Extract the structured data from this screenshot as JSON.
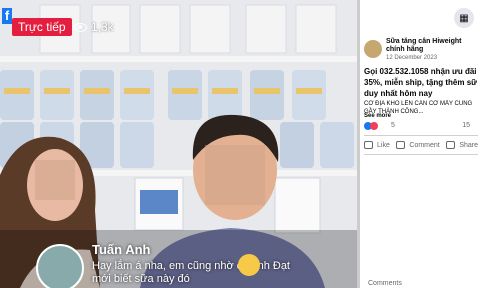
{
  "video": {
    "live_label": "Trực tiếp",
    "viewer_count": "1,3k",
    "comment": {
      "name": "Tuấn Anh",
      "text": "Hay lắm á nha, em cũng nhờ có anh Đạt mới biết sữa này đó"
    }
  },
  "post": {
    "author": "Sữa tăng cân Hiweight chính hãng",
    "date": "12 December 2023",
    "title_lines": [
      "Gọi 032.532.1058 nhận ưu đãi",
      "35%, miễn ship, tặng thêm sữ",
      "duy nhất hôm nay"
    ],
    "body_lines": [
      "CƠ ĐỊA KHÓ LÊN CÂN CỠ MẤY CŨNG",
      "GẦY THÀNH CÔNG..."
    ],
    "see_more": "See more",
    "reaction_count": "5",
    "comment_count": "15",
    "actions": {
      "like": "Like",
      "comment": "Comment",
      "share": "Share"
    }
  },
  "comments_label": "Comments",
  "colors": {
    "live_red": "#e41e3f",
    "fb_blue": "#1877f2"
  }
}
